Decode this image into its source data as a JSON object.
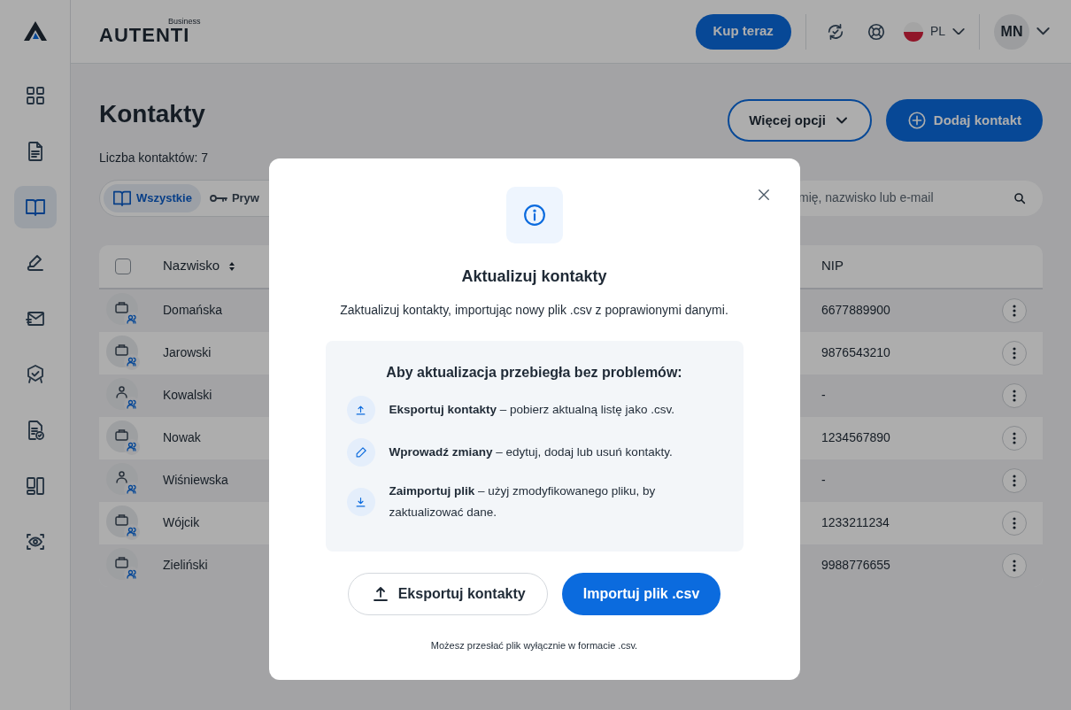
{
  "sidebar": {
    "items": [
      {
        "kind": "grid",
        "selected": false
      },
      {
        "kind": "document",
        "selected": false
      },
      {
        "kind": "book",
        "selected": true
      },
      {
        "kind": "pen",
        "selected": false
      },
      {
        "kind": "mail",
        "selected": false
      },
      {
        "kind": "badge",
        "selected": false
      },
      {
        "kind": "doccheck",
        "selected": false
      },
      {
        "kind": "layout",
        "selected": false
      },
      {
        "kind": "eye",
        "selected": false
      }
    ]
  },
  "header": {
    "logo": "AUTENTI",
    "logo_tag": "Business",
    "buy_button": "Kup teraz",
    "language": "PL",
    "avatar": "MN"
  },
  "page": {
    "title": "Kontakty",
    "count": "Liczba kontaktów: 7",
    "more_button": "Więcej opcji",
    "add_button": "Dodaj kontakt",
    "filters": [
      {
        "label": "Wszystkie",
        "kind": "book",
        "selected": true
      },
      {
        "label": "Pryw",
        "kind": "key",
        "selected": false
      }
    ],
    "search": {
      "placeholder": "mię, nazwisko lub e-mail"
    }
  },
  "table": {
    "select_all": {
      "checked": false
    },
    "columns": [
      "Nazwisko",
      "NIP"
    ],
    "rows": [
      {
        "kind": "company",
        "name": "Domańska",
        "nip": "6677889900"
      },
      {
        "kind": "company",
        "name": "Jarowski",
        "nip": "9876543210"
      },
      {
        "kind": "person",
        "name": "Kowalski",
        "nip": "-"
      },
      {
        "kind": "company",
        "name": "Nowak",
        "nip": "1234567890"
      },
      {
        "kind": "person",
        "name": "Wiśniewska",
        "nip": "-"
      },
      {
        "kind": "company",
        "name": "Wójcik",
        "nip": "1233211234"
      },
      {
        "kind": "company",
        "name": "Zieliński",
        "nip": "9988776655"
      }
    ]
  },
  "dialog": {
    "title": "Aktualizuj kontakty",
    "subtitle": "Zaktualizuj kontakty, importując nowy plik .csv z poprawionymi danymi.",
    "tips_title": "Aby aktualizacja przebiegła bez problemów:",
    "tips": [
      {
        "kind": "upload",
        "text": "**Eksportuj kontakty** – pobierz aktualną listę jako .csv."
      },
      {
        "kind": "edit",
        "text": "**Wprowadź zmiany** – edytuj, dodaj lub usuń kontakty."
      },
      {
        "kind": "download",
        "text": "**Zaimportuj plik** – użyj zmodyfikowanego pliku, by zaktualizować dane."
      }
    ],
    "buttons": [
      {
        "label": "Eksportuj kontakty",
        "kind": "secondary"
      },
      {
        "label": "Importuj plik .csv",
        "kind": "primary"
      }
    ],
    "note": "Możesz przesłać plik wyłącznie w formacie .csv."
  }
}
